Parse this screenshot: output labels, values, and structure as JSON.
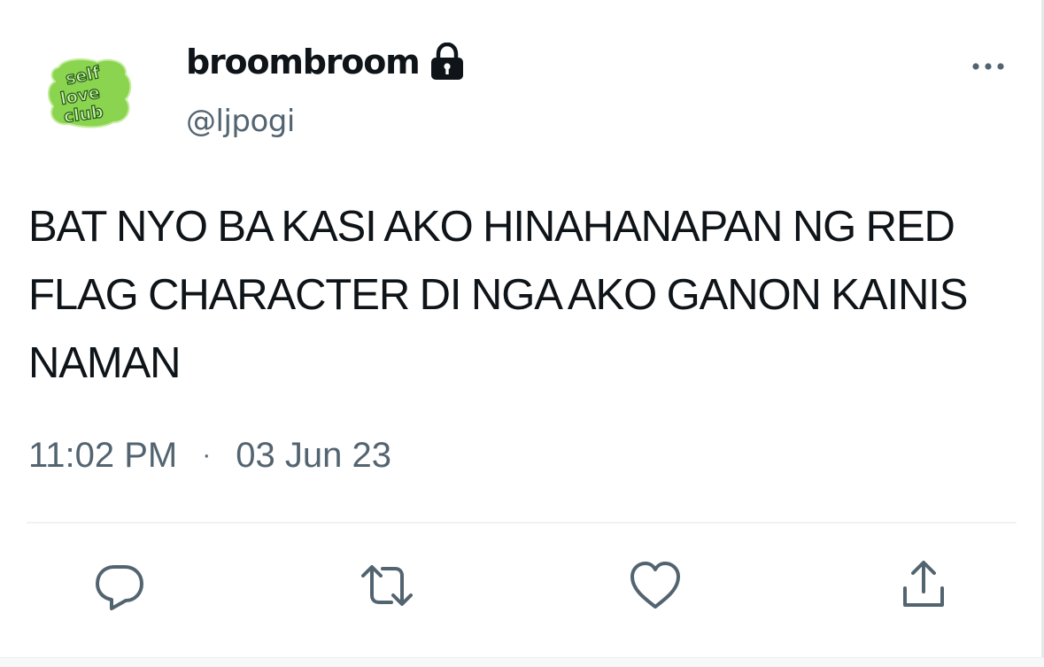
{
  "user": {
    "display_name": "broombroom",
    "handle": "@ljpogi",
    "protected_icon": "lock-icon",
    "avatar_text": [
      "self",
      "love",
      "club"
    ]
  },
  "tweet": {
    "text": "BAT NYO BA KASI AKO HINAHANAPAN NG RED FLAG CHARACTER DI NGA AKO GANON KAINIS NAMAN",
    "time": "11:02 PM",
    "separator": "·",
    "date": "03 Jun 23"
  },
  "actions": {
    "reply_icon": "reply-icon",
    "retweet_icon": "retweet-icon",
    "like_icon": "heart-icon",
    "share_icon": "share-icon"
  },
  "menu_icon": "more-icon",
  "colors": {
    "text": "#0f1419",
    "secondary": "#536471",
    "avatar_green": "#8bd450",
    "avatar_dark_green": "#1f5a12",
    "divider": "#eff3f4"
  }
}
